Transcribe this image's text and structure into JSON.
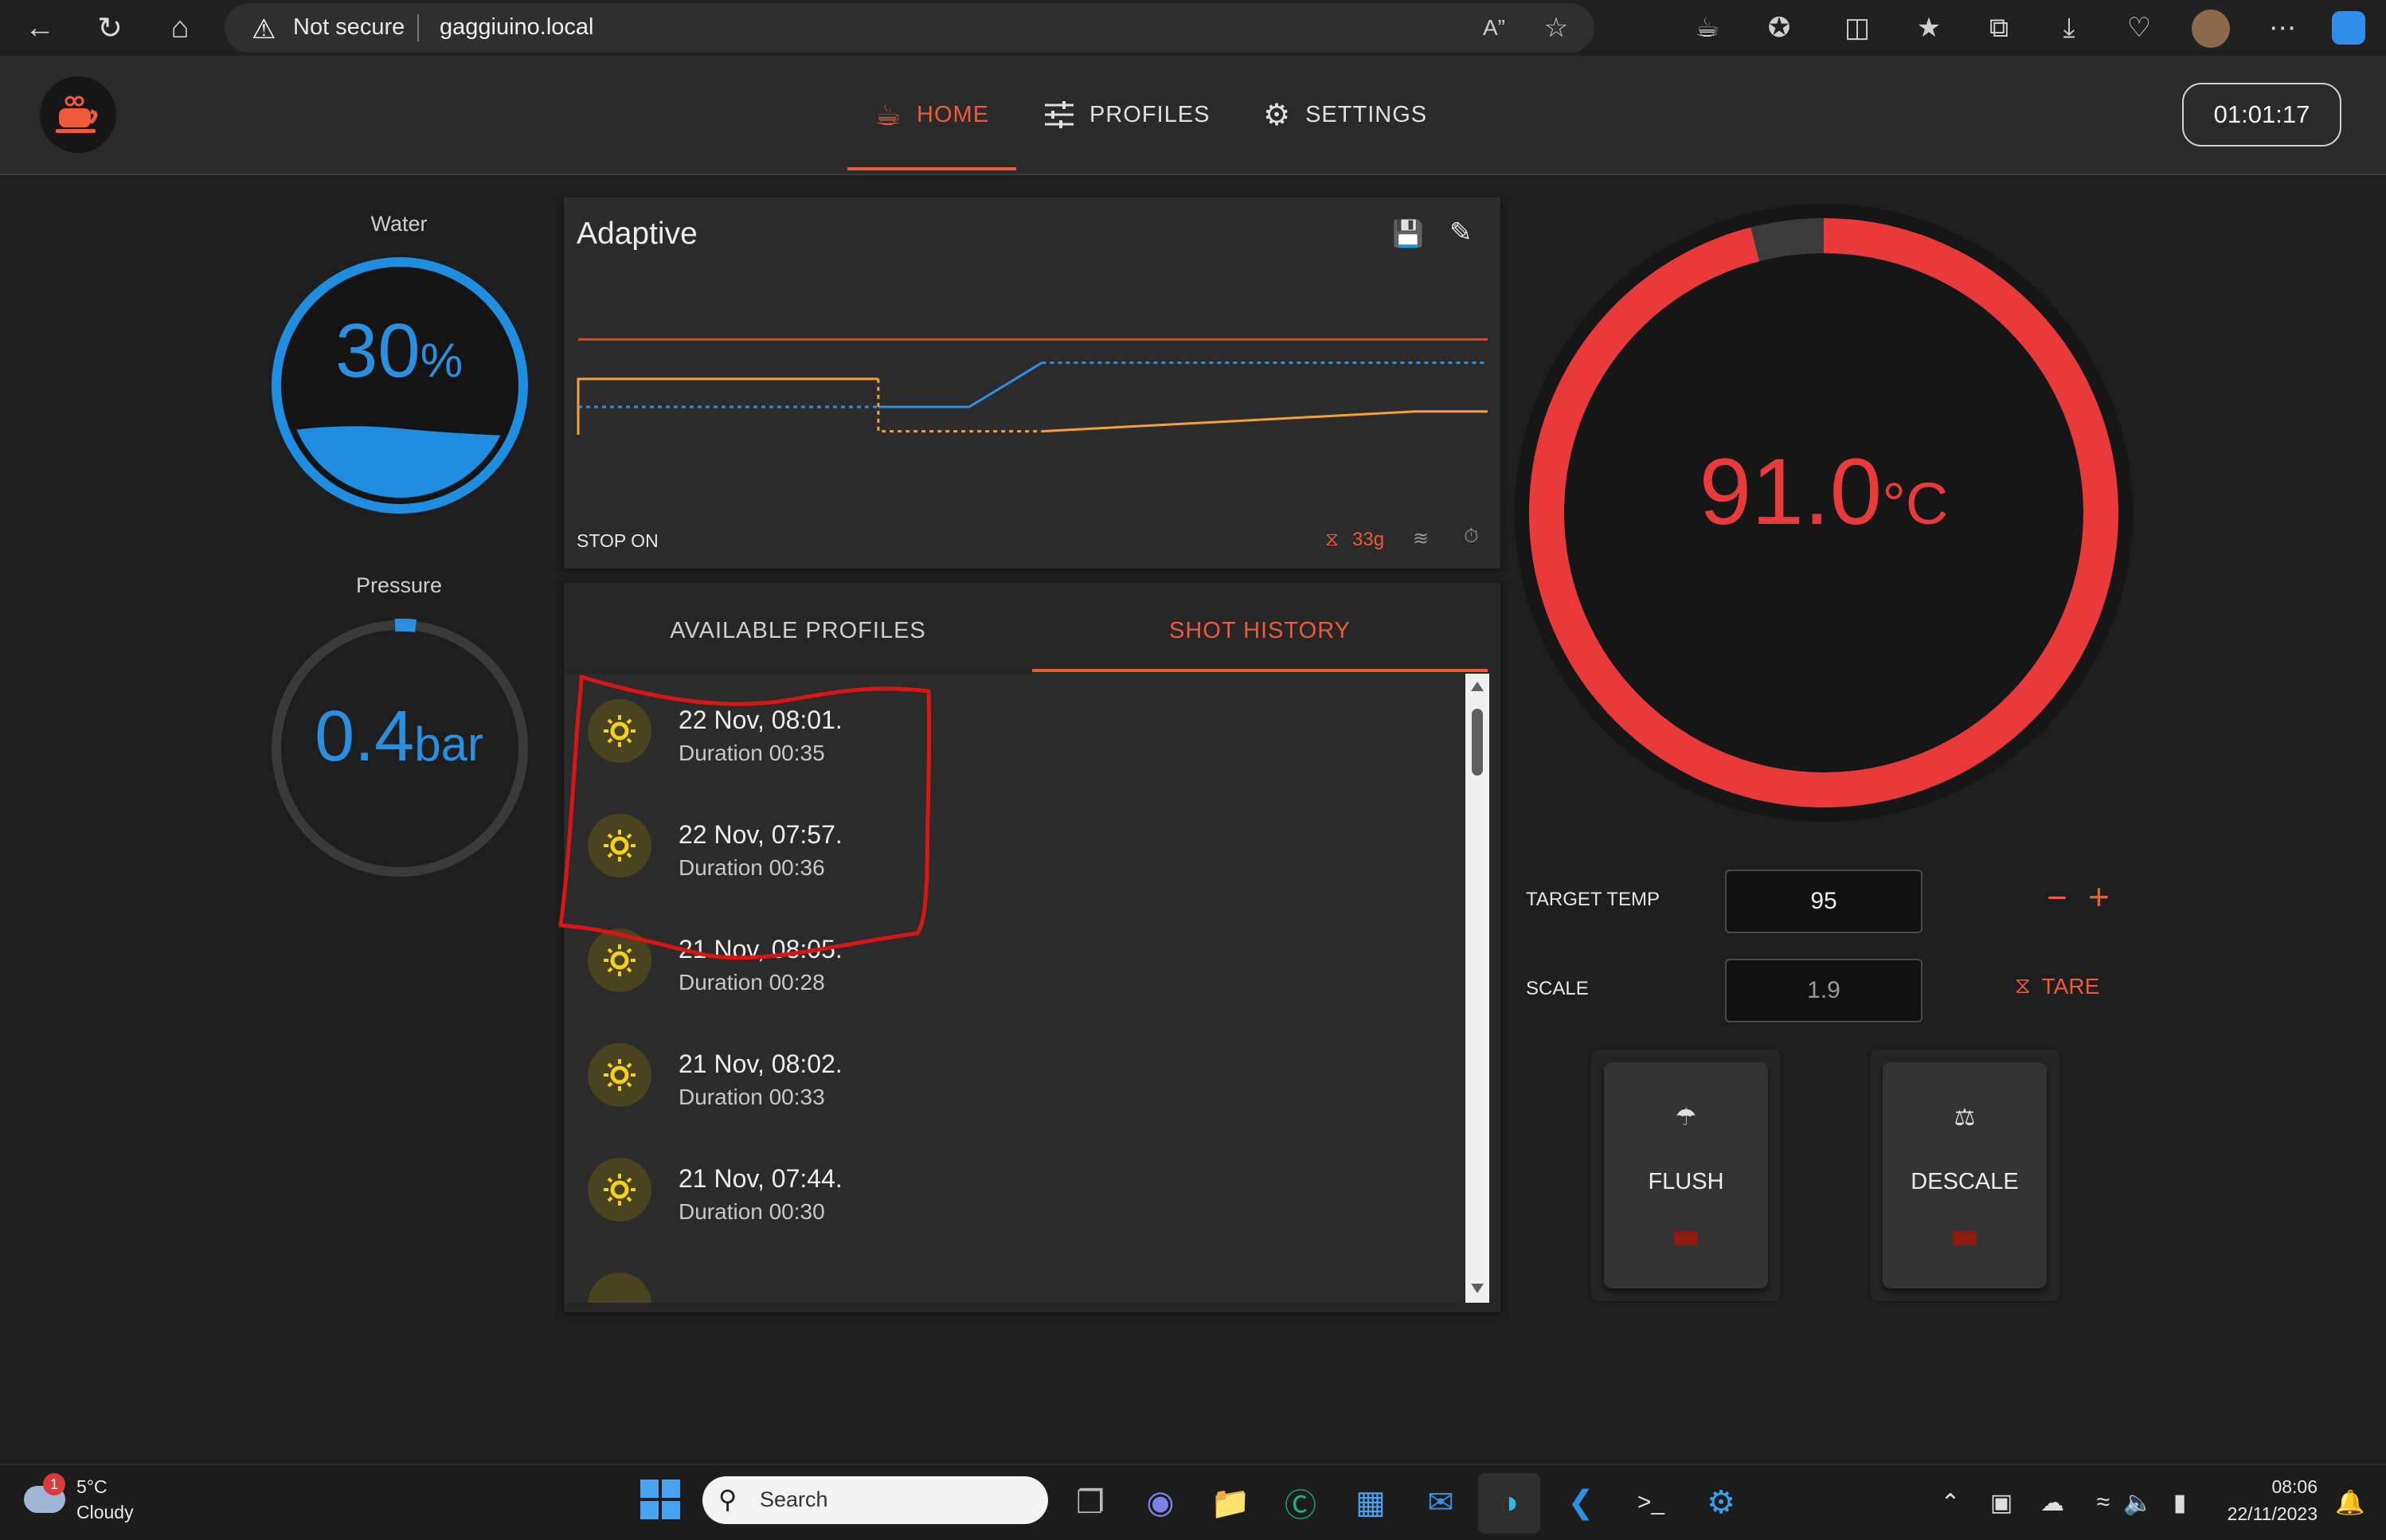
{
  "browser": {
    "security_label": "Not secure",
    "url": "gaggiuino.local"
  },
  "header": {
    "tabs": [
      {
        "label": "HOME",
        "icon": "coffee-cup-icon",
        "active": true
      },
      {
        "label": "PROFILES",
        "icon": "sliders-icon",
        "active": false
      },
      {
        "label": "SETTINGS",
        "icon": "gear-icon",
        "active": false
      }
    ],
    "clock": "01:01:17"
  },
  "water": {
    "label": "Water",
    "value": "30",
    "unit": "%",
    "level_fraction": 0.3
  },
  "pressure": {
    "label": "Pressure",
    "value": "0.4",
    "unit": "bar"
  },
  "profile_card": {
    "name": "Adaptive",
    "stop_label": "STOP ON",
    "stop_weight": "33g"
  },
  "chart_data": {
    "type": "line",
    "title": "",
    "xlabel": "",
    "ylabel": "",
    "x_range": [
      0,
      100
    ],
    "y_range": [
      0,
      100
    ],
    "series": [
      {
        "color": "#e2452f",
        "style": "solid",
        "points": [
          [
            0,
            82
          ],
          [
            100,
            82
          ]
        ]
      },
      {
        "color": "#2f8fe0",
        "style": "dashed",
        "points": [
          [
            0,
            24
          ],
          [
            43,
            24
          ]
        ]
      },
      {
        "color": "#2f8fe0",
        "style": "solid",
        "points": [
          [
            33,
            24
          ],
          [
            43,
            24
          ],
          [
            51,
            62
          ]
        ]
      },
      {
        "color": "#2f8fe0",
        "style": "dashed",
        "points": [
          [
            51,
            62
          ],
          [
            100,
            62
          ]
        ]
      },
      {
        "color": "#f2a13a",
        "style": "solid",
        "points": [
          [
            0,
            0
          ],
          [
            0,
            48
          ],
          [
            33,
            48
          ]
        ]
      },
      {
        "color": "#f2a13a",
        "style": "dashed",
        "points": [
          [
            33,
            48
          ],
          [
            33,
            3
          ],
          [
            51,
            3
          ]
        ]
      },
      {
        "color": "#f2a13a",
        "style": "solid",
        "points": [
          [
            51,
            3
          ],
          [
            92,
            20
          ],
          [
            100,
            20
          ]
        ]
      }
    ]
  },
  "list": {
    "tabs": [
      "AVAILABLE PROFILES",
      "SHOT HISTORY"
    ],
    "shots": [
      {
        "title": "22 Nov, 08:01.",
        "duration": "Duration 00:35"
      },
      {
        "title": "22 Nov, 07:57.",
        "duration": "Duration 00:36"
      },
      {
        "title": "21 Nov, 08:05.",
        "duration": "Duration 00:28"
      },
      {
        "title": "21 Nov, 08:02.",
        "duration": "Duration 00:33"
      },
      {
        "title": "21 Nov, 07:44.",
        "duration": "Duration 00:30"
      }
    ]
  },
  "temperature": {
    "value": "91.0",
    "unit": "°C",
    "progress_fraction": 0.96,
    "color": "#e83a3a"
  },
  "controls": {
    "target_temp_label": "TARGET TEMP",
    "target_temp_value": "95",
    "scale_label": "SCALE",
    "scale_value": "1.9",
    "tare_label": "TARE",
    "minus": "−",
    "plus": "+"
  },
  "actions": {
    "flush_label": "FLUSH",
    "descale_label": "DESCALE"
  },
  "taskbar": {
    "weather_temp": "5°C",
    "weather_desc": "Cloudy",
    "weather_badge": "1",
    "search_placeholder": "Search",
    "time": "08:06",
    "date": "22/11/2023"
  },
  "colors": {
    "accent": "#ef5a3a",
    "water_blue": "#2b8fe0",
    "temp_red": "#e83a3a"
  }
}
